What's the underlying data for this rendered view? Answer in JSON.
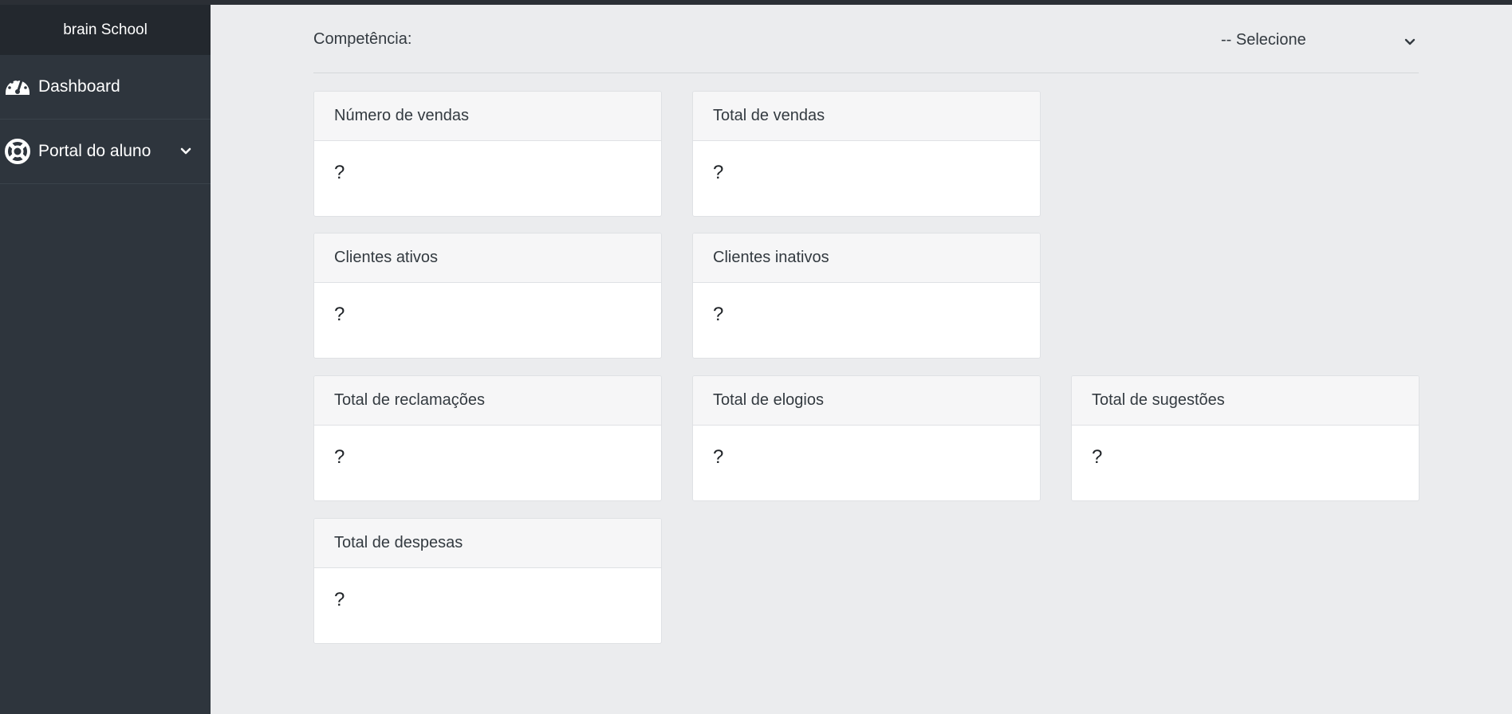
{
  "sidebar": {
    "brand": "brain School",
    "items": [
      {
        "label": "Dashboard",
        "icon": "dashboard-gauge-icon"
      },
      {
        "label": "Portal do aluno",
        "icon": "life-ring-icon",
        "has_submenu": true
      }
    ]
  },
  "filter": {
    "label": "Competência:",
    "selected": "-- Selecione"
  },
  "cards": [
    {
      "title": "Número de vendas",
      "value": "?"
    },
    {
      "title": "Total de vendas",
      "value": "?"
    },
    {
      "title": "Clientes ativos",
      "value": "?"
    },
    {
      "title": "Clientes inativos",
      "value": "?"
    },
    {
      "title": "Total de reclamações",
      "value": "?"
    },
    {
      "title": "Total de elogios",
      "value": "?"
    },
    {
      "title": "Total de sugestões",
      "value": "?"
    },
    {
      "title": "Total de despesas",
      "value": "?"
    }
  ],
  "colors": {
    "sidebar_bg": "#2e353d",
    "brand_bg": "#23282e",
    "page_bg": "#ebecee",
    "card_header_bg": "#f6f6f7"
  }
}
